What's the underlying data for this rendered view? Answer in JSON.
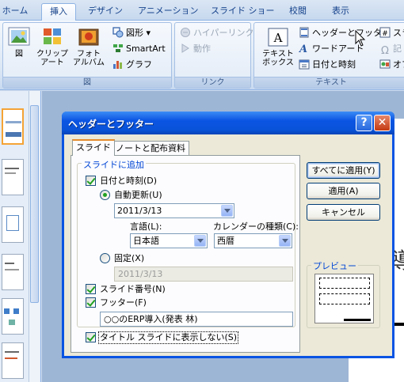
{
  "ribbon": {
    "tabs": [
      "ホーム",
      "挿入",
      "デザイン",
      "アニメーション",
      "スライド ショー",
      "校閲",
      "表示"
    ],
    "active_tab": "挿入",
    "groups": {
      "image": {
        "label": "図",
        "picture": "図",
        "clipart": "クリップ\nアート",
        "album": "フォト\nアルバム",
        "shapes": "図形",
        "smartart": "SmartArt",
        "chart": "グラフ"
      },
      "link": {
        "label": "リンク",
        "hyperlink": "ハイパーリンク",
        "action": "動作"
      },
      "text": {
        "label": "テキスト",
        "textbox": "テキスト\nボックス",
        "header_footer": "ヘッダーとフッター",
        "wordart": "ワードアート",
        "datetime": "日付と時刻",
        "symbol_partial": "スラ",
        "special_partial": "記",
        "object_partial": "オブ"
      }
    }
  },
  "canvas_text": "導",
  "dialog": {
    "title": "ヘッダーとフッター",
    "help_glyph": "?",
    "close_glyph": "✕",
    "tabs": [
      "スライド",
      "ノートと配布資料"
    ],
    "active_tab": "スライド",
    "group_label": "スライドに追加",
    "datetime": {
      "label": "日付と時刻(D)",
      "checked": true
    },
    "auto_update": {
      "label": "自動更新(U)",
      "selected": true,
      "value": "2011/3/13"
    },
    "language": {
      "label": "言語(L):",
      "value": "日本語"
    },
    "calendar": {
      "label": "カレンダーの種類(C):",
      "value": "西暦"
    },
    "fixed": {
      "label": "固定(X)",
      "selected": false,
      "value": "2011/3/13"
    },
    "slide_number": {
      "label": "スライド番号(N)",
      "checked": true
    },
    "footer": {
      "label": "フッター(F)",
      "checked": true,
      "value": "○○のERP導入(発表 林)"
    },
    "hide_on_title": {
      "label": "タイトル スライドに表示しない(S)",
      "checked": true
    },
    "buttons": {
      "apply_all": "すべてに適用(Y)",
      "apply": "適用(A)",
      "cancel": "キャンセル"
    },
    "preview_label": "プレビュー"
  }
}
